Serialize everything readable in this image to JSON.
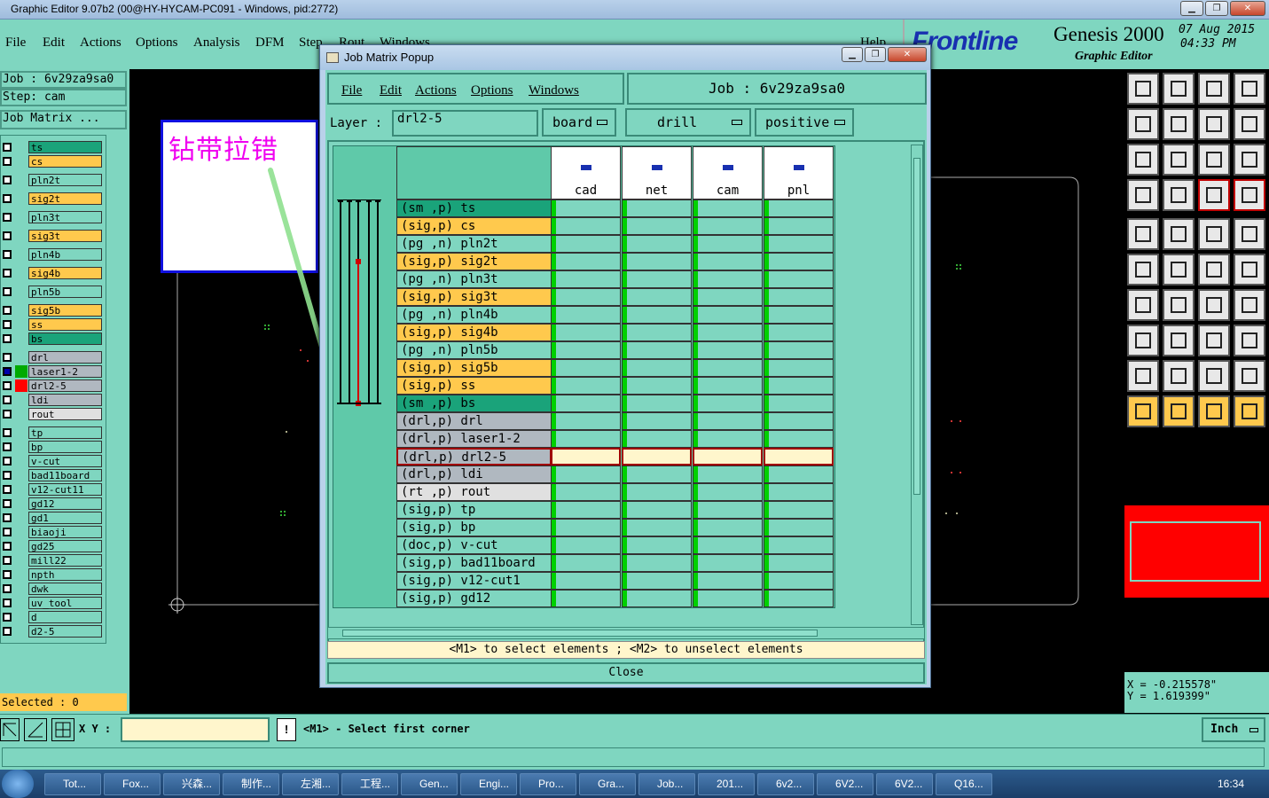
{
  "window": {
    "title": "Graphic Editor 9.07b2 (00@HY-HYCAM-PC091 - Windows, pid:2772)"
  },
  "menu": {
    "items": [
      "File",
      "Edit",
      "Actions",
      "Options",
      "Analysis",
      "DFM",
      "Step",
      "Rout",
      "Windows",
      "Help"
    ]
  },
  "brand": {
    "logo": "Frontline",
    "product": "Genesis 2000",
    "subtitle": "Graphic Editor",
    "date": "07 Aug 2015",
    "time": "04:33 PM"
  },
  "left": {
    "job": "Job : 6v29za9sa0",
    "step": "Step: cam",
    "job_matrix": "Job Matrix ...",
    "selected": "Selected : 0",
    "layers": [
      {
        "name": "ts",
        "color": "#1aa37a",
        "swatch": ""
      },
      {
        "name": "cs",
        "color": "#ffc94d",
        "swatch": ""
      },
      {
        "name": "pln2t",
        "color": "#7fd6c0",
        "swatch": ""
      },
      {
        "name": "sig2t",
        "color": "#ffc94d",
        "swatch": ""
      },
      {
        "name": "pln3t",
        "color": "#7fd6c0",
        "swatch": ""
      },
      {
        "name": "sig3t",
        "color": "#ffc94d",
        "swatch": ""
      },
      {
        "name": "pln4b",
        "color": "#7fd6c0",
        "swatch": ""
      },
      {
        "name": "sig4b",
        "color": "#ffc94d",
        "swatch": ""
      },
      {
        "name": "pln5b",
        "color": "#7fd6c0",
        "swatch": ""
      },
      {
        "name": "sig5b",
        "color": "#ffc94d",
        "swatch": ""
      },
      {
        "name": "ss",
        "color": "#ffc94d",
        "swatch": ""
      },
      {
        "name": "bs",
        "color": "#1aa37a",
        "swatch": ""
      },
      {
        "name": "drl",
        "color": "#b0b8c0",
        "swatch": ""
      },
      {
        "name": "laser1-2",
        "color": "#b0b8c0",
        "swatch": "#00aa00",
        "checked": true
      },
      {
        "name": "drl2-5",
        "color": "#b0b8c0",
        "swatch": "#ff0000"
      },
      {
        "name": "ldi",
        "color": "#b0b8c0",
        "swatch": ""
      },
      {
        "name": "rout",
        "color": "#e0e0e0",
        "swatch": ""
      },
      {
        "name": "tp",
        "color": "#7fd6c0",
        "swatch": ""
      },
      {
        "name": "bp",
        "color": "#7fd6c0",
        "swatch": ""
      },
      {
        "name": "v-cut",
        "color": "#7fd6c0",
        "swatch": ""
      },
      {
        "name": "bad11board",
        "color": "#7fd6c0",
        "swatch": ""
      },
      {
        "name": "v12-cut11",
        "color": "#7fd6c0",
        "swatch": ""
      },
      {
        "name": "gd12",
        "color": "#7fd6c0",
        "swatch": ""
      },
      {
        "name": "gd1",
        "color": "#7fd6c0",
        "swatch": ""
      },
      {
        "name": "biaoji",
        "color": "#7fd6c0",
        "swatch": ""
      },
      {
        "name": "gd25",
        "color": "#7fd6c0",
        "swatch": ""
      },
      {
        "name": "mill22",
        "color": "#7fd6c0",
        "swatch": ""
      },
      {
        "name": "npth",
        "color": "#7fd6c0",
        "swatch": ""
      },
      {
        "name": "dwk",
        "color": "#7fd6c0",
        "swatch": ""
      },
      {
        "name": "uv_tool",
        "color": "#7fd6c0",
        "swatch": ""
      },
      {
        "name": "d",
        "color": "#7fd6c0",
        "swatch": ""
      },
      {
        "name": "d2-5",
        "color": "#7fd6c0",
        "swatch": ""
      }
    ]
  },
  "annotation": {
    "text": "钻带拉错"
  },
  "popup": {
    "title": "Job Matrix Popup",
    "menu": [
      "File",
      "Edit",
      "Actions",
      "Options",
      "Windows"
    ],
    "job": "Job : 6v29za9sa0",
    "layer_label": "Layer :",
    "layer_value": "drl2-5",
    "context": "board",
    "type": "drill",
    "polarity": "positive",
    "columns": [
      "cad",
      "net",
      "cam",
      "pnl"
    ],
    "rows": [
      {
        "label": "(sm ,p) ts",
        "color": "#1aa37a"
      },
      {
        "label": "(sig,p) cs",
        "color": "#ffc94d"
      },
      {
        "label": "(pg ,n) pln2t",
        "color": "#7fd6c0"
      },
      {
        "label": "(sig,p) sig2t",
        "color": "#ffc94d"
      },
      {
        "label": "(pg ,n) pln3t",
        "color": "#7fd6c0"
      },
      {
        "label": "(sig,p) sig3t",
        "color": "#ffc94d"
      },
      {
        "label": "(pg ,n) pln4b",
        "color": "#7fd6c0"
      },
      {
        "label": "(sig,p) sig4b",
        "color": "#ffc94d"
      },
      {
        "label": "(pg ,n) pln5b",
        "color": "#7fd6c0"
      },
      {
        "label": "(sig,p) sig5b",
        "color": "#ffc94d"
      },
      {
        "label": "(sig,p) ss",
        "color": "#ffc94d"
      },
      {
        "label": "(sm ,p) bs",
        "color": "#1aa37a"
      },
      {
        "label": "(drl,p) drl",
        "color": "#b0b8c0"
      },
      {
        "label": "(drl,p) laser1-2",
        "color": "#b0b8c0"
      },
      {
        "label": "(drl,p) drl2-5",
        "color": "#b0b8c0",
        "selected": true
      },
      {
        "label": "(drl,p) ldi",
        "color": "#b0b8c0"
      },
      {
        "label": "(rt ,p) rout",
        "color": "#e0e0e0"
      },
      {
        "label": "(sig,p) tp",
        "color": "#7fd6c0"
      },
      {
        "label": "(sig,p) bp",
        "color": "#7fd6c0"
      },
      {
        "label": "(doc,p) v-cut",
        "color": "#7fd6c0"
      },
      {
        "label": "(sig,p) bad11board",
        "color": "#7fd6c0"
      },
      {
        "label": "(sig,p) v12-cut1",
        "color": "#7fd6c0"
      },
      {
        "label": "(sig,p) gd12",
        "color": "#7fd6c0"
      }
    ],
    "hint": "<M1> to select elements ; <M2> to unselect elements",
    "close": "Close"
  },
  "coords": {
    "x": "X = -0.215578\"",
    "y": "Y = 1.619399\""
  },
  "status": {
    "xy_label": "X Y :",
    "message": "<M1> - Select first corner",
    "units": "Inch"
  },
  "taskbar": {
    "items": [
      "Tot...",
      "Fox...",
      "兴森...",
      "制作...",
      "左湘...",
      "工程...",
      "Gen...",
      "Engi...",
      "Pro...",
      "Gra...",
      "Job...",
      "201...",
      "6v2...",
      "6V2...",
      "6V2...",
      "Q16..."
    ],
    "clock": "16:34"
  }
}
